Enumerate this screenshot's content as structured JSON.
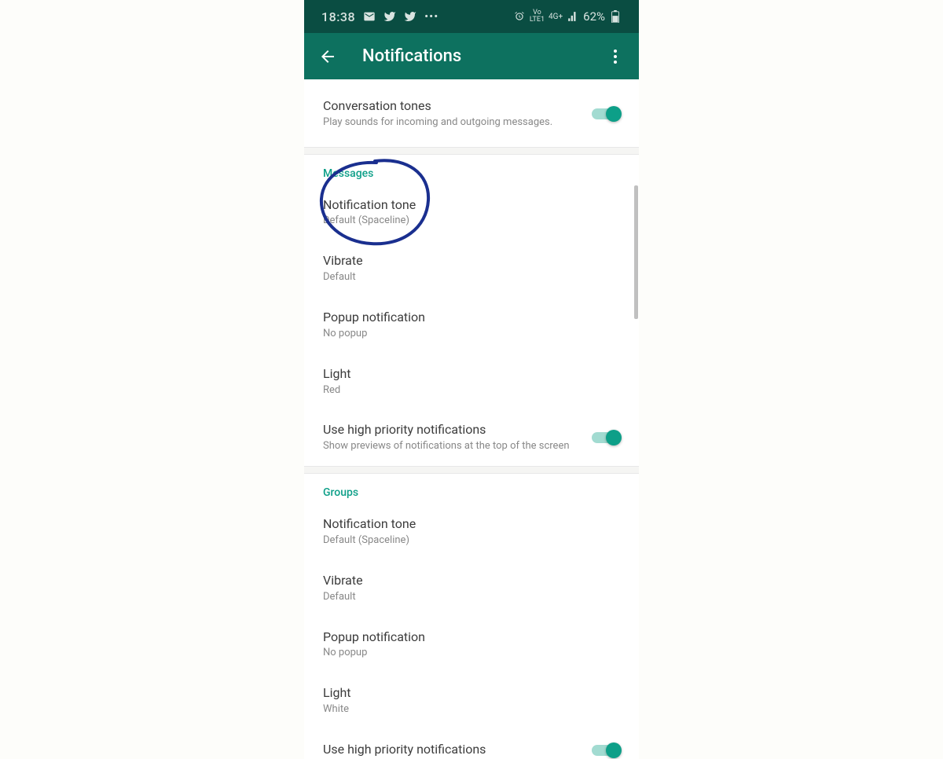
{
  "status_bar": {
    "time": "18:38",
    "battery_text": "62%",
    "network_label": "4G+",
    "lte_label": "LTE1",
    "vo_label": "Vo"
  },
  "app_bar": {
    "title": "Notifications"
  },
  "settings": {
    "conversation_tones": {
      "title": "Conversation tones",
      "subtitle": "Play sounds for incoming and outgoing messages."
    },
    "messages": {
      "header": "Messages",
      "notification_tone": {
        "title": "Notification tone",
        "subtitle": "Default (Spaceline)"
      },
      "vibrate": {
        "title": "Vibrate",
        "subtitle": "Default"
      },
      "popup": {
        "title": "Popup notification",
        "subtitle": "No popup"
      },
      "light": {
        "title": "Light",
        "subtitle": "Red"
      },
      "high_priority": {
        "title": "Use high priority notifications",
        "subtitle": "Show previews of notifications at the top of the screen"
      }
    },
    "groups": {
      "header": "Groups",
      "notification_tone": {
        "title": "Notification tone",
        "subtitle": "Default (Spaceline)"
      },
      "vibrate": {
        "title": "Vibrate",
        "subtitle": "Default"
      },
      "popup": {
        "title": "Popup notification",
        "subtitle": "No popup"
      },
      "light": {
        "title": "Light",
        "subtitle": "White"
      },
      "high_priority": {
        "title": "Use high priority notifications"
      }
    }
  }
}
